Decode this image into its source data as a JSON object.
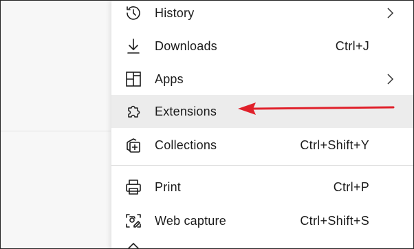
{
  "menu": {
    "items": [
      {
        "label": "History",
        "shortcut": "",
        "icon": "history-icon",
        "has_submenu": true
      },
      {
        "label": "Downloads",
        "shortcut": "Ctrl+J",
        "icon": "download-icon",
        "has_submenu": false
      },
      {
        "label": "Apps",
        "shortcut": "",
        "icon": "apps-icon",
        "has_submenu": true
      },
      {
        "label": "Extensions",
        "shortcut": "",
        "icon": "puzzle-icon",
        "has_submenu": false
      },
      {
        "label": "Collections",
        "shortcut": "Ctrl+Shift+Y",
        "icon": "collections-icon",
        "has_submenu": false
      },
      {
        "label": "Print",
        "shortcut": "Ctrl+P",
        "icon": "printer-icon",
        "has_submenu": false
      },
      {
        "label": "Web capture",
        "shortcut": "Ctrl+Shift+S",
        "icon": "web-capture-icon",
        "has_submenu": false
      }
    ],
    "highlighted_item": "Extensions"
  },
  "annotation": {
    "arrow_color": "#e0202a",
    "points_to": "Extensions"
  },
  "colors": {
    "menu_background": "#ffffff",
    "highlight_background": "#ececec",
    "text": "#1b1b1b"
  }
}
